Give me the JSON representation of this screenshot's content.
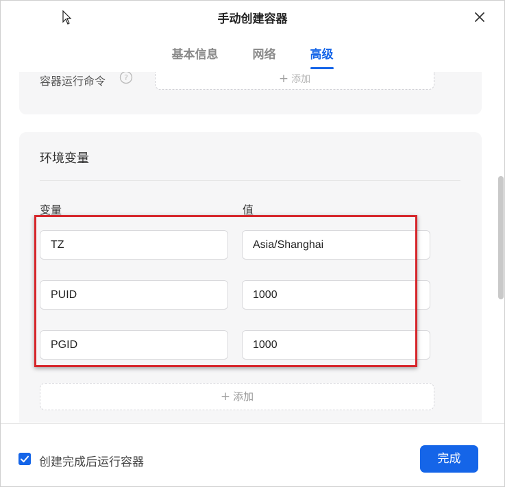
{
  "dialog": {
    "title": "手动创建容器"
  },
  "tabs": [
    {
      "label": "基本信息",
      "active": false
    },
    {
      "label": "网络",
      "active": false
    },
    {
      "label": "高级",
      "active": true
    }
  ],
  "run_command": {
    "label": "容器运行命令",
    "add_label": "添加"
  },
  "env": {
    "title": "环境变量",
    "key_header": "变量",
    "value_header": "值",
    "rows": [
      {
        "key": "TZ",
        "value": "Asia/Shanghai"
      },
      {
        "key": "PUID",
        "value": "1000"
      },
      {
        "key": "PGID",
        "value": "1000"
      }
    ],
    "add_label": "添加"
  },
  "footer": {
    "run_after_create_label": "创建完成后运行容器",
    "run_after_create_checked": true,
    "done_label": "完成"
  },
  "colors": {
    "accent": "#1565e8",
    "highlight": "#d6262b"
  }
}
